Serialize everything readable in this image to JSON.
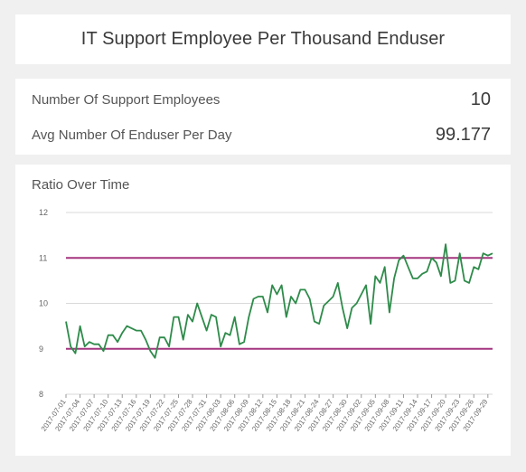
{
  "title": "IT Support Employee Per Thousand Enduser",
  "kpis": [
    {
      "label": "Number Of Support Employees",
      "value": "10"
    },
    {
      "label": "Avg Number Of Enduser Per Day",
      "value": "99.177"
    }
  ],
  "chart_data": {
    "type": "line",
    "title": "Ratio Over Time",
    "ylim": [
      8,
      12
    ],
    "yticks": [
      "8",
      "9",
      "10",
      "11",
      "12"
    ],
    "x_tick_labels": [
      "2017-07-01",
      "2017-07-04",
      "2017-07-07",
      "2017-07-10",
      "2017-07-13",
      "2017-07-16",
      "2017-07-19",
      "2017-07-22",
      "2017-07-25",
      "2017-07-28",
      "2017-07-31",
      "2017-08-03",
      "2017-08-06",
      "2017-08-09",
      "2017-08-12",
      "2017-08-15",
      "2017-08-18",
      "2017-08-21",
      "2017-08-24",
      "2017-08-27",
      "2017-08-30",
      "2017-09-02",
      "2017-09-05",
      "2017-09-08",
      "2017-09-11",
      "2017-09-14",
      "2017-09-17",
      "2017-09-20",
      "2017-09-23",
      "2017-09-26",
      "2017-09-29"
    ],
    "x_range": [
      "2017-07-01",
      "2017-09-30"
    ],
    "series": [
      {
        "color": "#2e8b4a",
        "values": [
          9.6,
          9.05,
          8.9,
          9.5,
          9.05,
          9.15,
          9.1,
          9.1,
          8.95,
          9.3,
          9.3,
          9.15,
          9.35,
          9.5,
          9.45,
          9.4,
          9.4,
          9.2,
          8.95,
          8.8,
          9.25,
          9.25,
          9.05,
          9.7,
          9.7,
          9.2,
          9.75,
          9.6,
          10.0,
          9.7,
          9.4,
          9.75,
          9.7,
          9.05,
          9.35,
          9.3,
          9.7,
          9.1,
          9.15,
          9.7,
          10.1,
          10.15,
          10.15,
          9.8,
          10.4,
          10.2,
          10.4,
          9.7,
          10.15,
          10.0,
          10.3,
          10.3,
          10.1,
          9.6,
          9.55,
          9.95,
          10.05,
          10.15,
          10.45,
          9.9,
          9.45,
          9.9,
          10.0,
          10.2,
          10.4,
          9.55,
          10.6,
          10.45,
          10.8,
          9.8,
          10.55,
          10.95,
          11.05,
          10.8,
          10.55,
          10.55,
          10.65,
          10.7,
          11.0,
          10.9,
          10.6,
          11.3,
          10.45,
          10.5,
          11.1,
          10.5,
          10.45,
          10.8,
          10.75,
          11.1,
          11.05,
          11.1
        ]
      }
    ],
    "reference_lines": [
      {
        "value": 11,
        "color": "#a4357f"
      },
      {
        "value": 9,
        "color": "#a4357f"
      }
    ],
    "grid": true
  }
}
